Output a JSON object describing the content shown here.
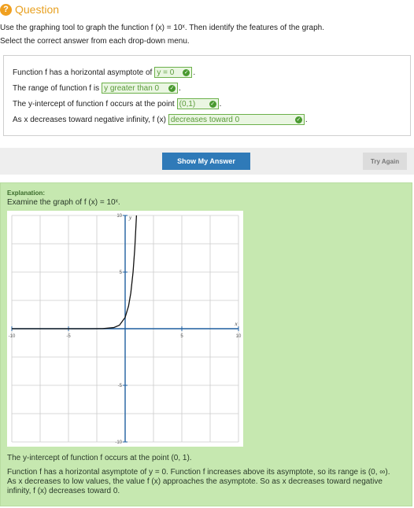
{
  "header": {
    "badge": "?",
    "title": "Question"
  },
  "instructions": {
    "line1": "Use the graphing tool to graph the function f (x) = 10ˣ. Then identify the features of the graph.",
    "line2": "Select the correct answer from each drop-down menu."
  },
  "question": {
    "rows": [
      {
        "prefix": "Function f has a horizontal asymptote of",
        "answer": "y = 0",
        "suffix": "."
      },
      {
        "prefix": "The range of function f is",
        "answer": "y greater than 0",
        "suffix": "."
      },
      {
        "prefix": "The y-intercept of function f occurs at the point",
        "answer": "(0,1)",
        "suffix": "."
      },
      {
        "prefix": "As x decreases toward negative infinity, f (x)",
        "answer": "decreases toward 0",
        "suffix": "."
      }
    ]
  },
  "buttons": {
    "show_answer": "Show My Answer",
    "try_again": "Try Again"
  },
  "explanation": {
    "heading": "Explanation:",
    "intro": "Examine the graph of f (x) = 10ˣ.",
    "p1": "The y-intercept of function f occurs at the point (0, 1).",
    "p2": "Function f has a horizontal asymptote of y = 0. Function f increases above its asymptote, so its range is (0, ∞). As x decreases to low values, the value f (x) approaches the asymptote. So as x decreases toward negative infinity, f (x) decreases toward 0."
  },
  "chart_data": {
    "type": "line",
    "function": "10^x",
    "xlim": [
      -10,
      10
    ],
    "ylim": [
      -10,
      10
    ],
    "xlabel": "x",
    "ylabel": "y",
    "x_ticks": [
      "-10",
      "-5",
      "5",
      "10"
    ],
    "y_ticks": [
      "10",
      "5",
      "-5",
      "-10"
    ],
    "grid": true,
    "series": [
      {
        "x": [
          -10,
          -3,
          -2,
          -1,
          -0.5,
          0,
          0.3,
          0.5,
          0.7,
          0.85,
          1
        ],
        "y": [
          0,
          0.001,
          0.01,
          0.1,
          0.316,
          1,
          2,
          3.16,
          5.01,
          7.08,
          10
        ]
      }
    ]
  }
}
